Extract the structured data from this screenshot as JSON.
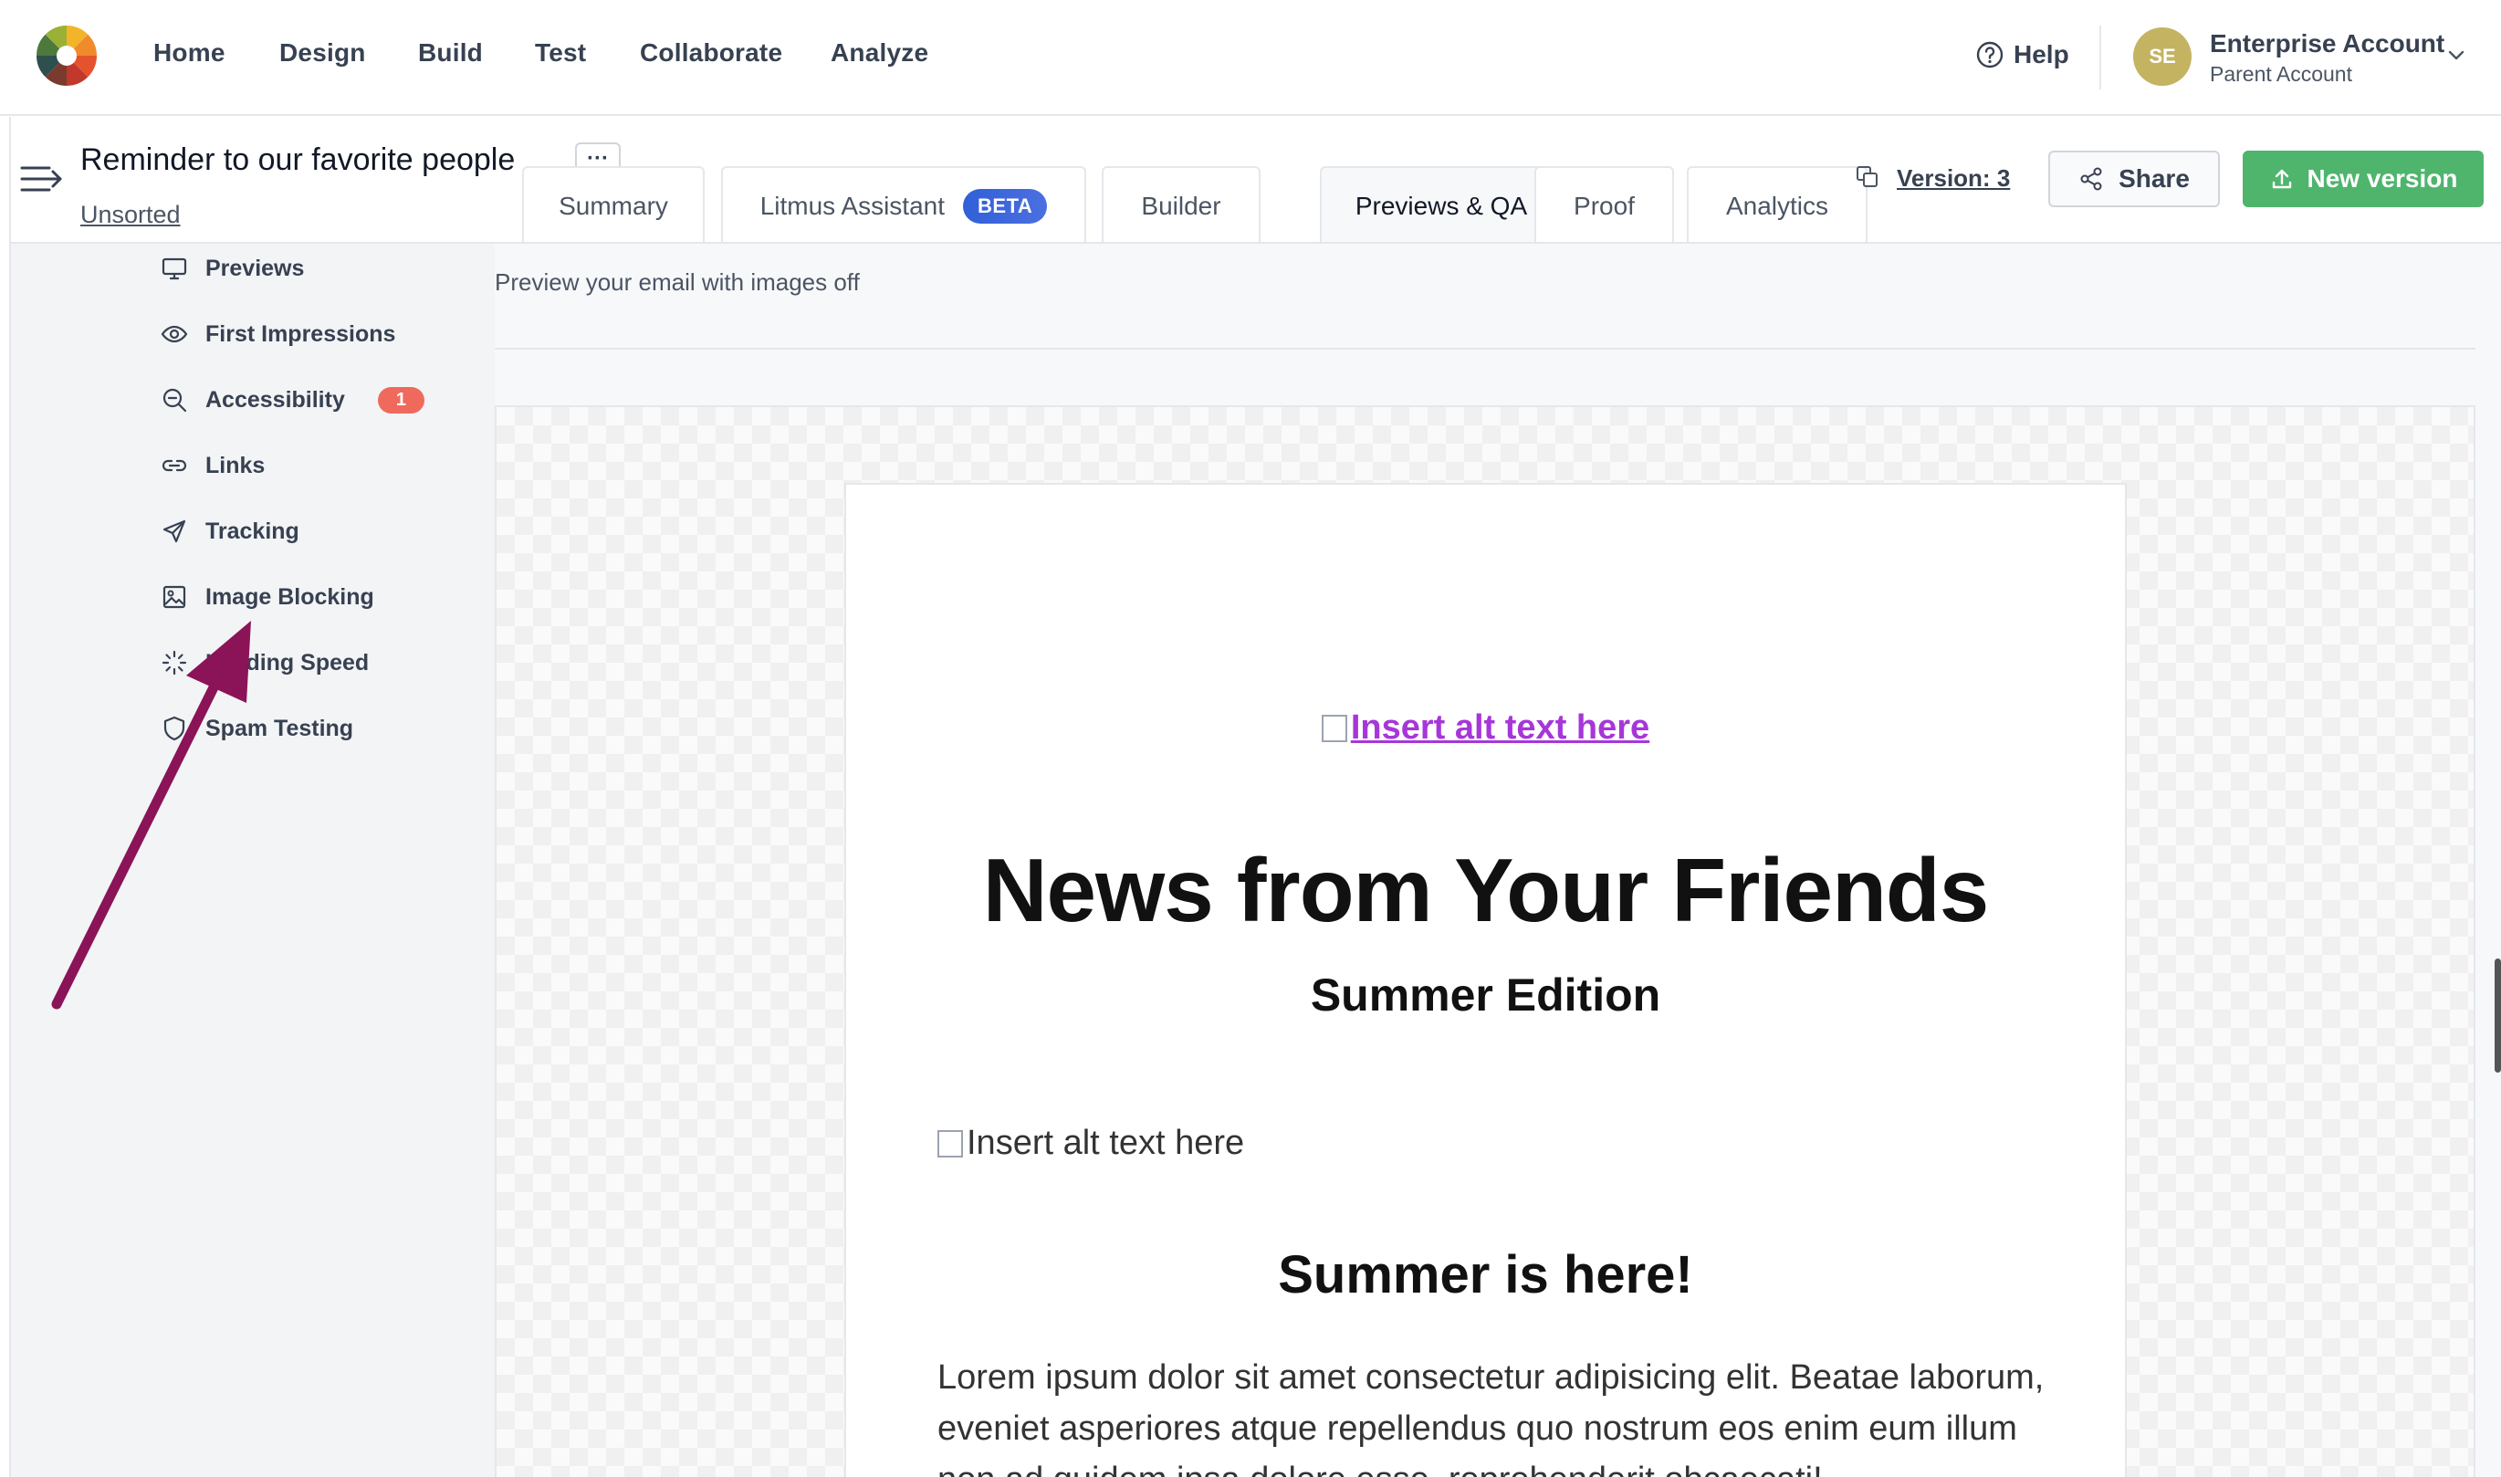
{
  "nav": {
    "items": [
      "Home",
      "Design",
      "Build",
      "Test",
      "Collaborate",
      "Analyze"
    ],
    "help": "Help",
    "account": {
      "initials": "SE",
      "name": "Enterprise Account",
      "sub": "Parent Account"
    }
  },
  "project": {
    "title": "Reminder to our favorite people",
    "more": "···",
    "folder": "Unsorted"
  },
  "tabs": [
    {
      "label": "Summary"
    },
    {
      "label": "Litmus Assistant",
      "badge": "BETA"
    },
    {
      "label": "Builder"
    },
    {
      "label": "Previews & QA"
    },
    {
      "label": "Proof"
    },
    {
      "label": "Analytics"
    }
  ],
  "actions": {
    "version": "Version: 3",
    "share": "Share",
    "new_version": "New version"
  },
  "sidebar": {
    "items": [
      {
        "label": "Previews",
        "icon": "monitor-icon"
      },
      {
        "label": "First Impressions",
        "icon": "eye-icon"
      },
      {
        "label": "Accessibility",
        "icon": "magnifier-icon",
        "badge": "1"
      },
      {
        "label": "Links",
        "icon": "link-icon"
      },
      {
        "label": "Tracking",
        "icon": "send-icon"
      },
      {
        "label": "Image Blocking",
        "icon": "image-icon"
      },
      {
        "label": "Loading Speed",
        "icon": "spinner-icon"
      },
      {
        "label": "Spam Testing",
        "icon": "shield-icon"
      }
    ]
  },
  "main": {
    "caption": "Preview your email with images off",
    "email": {
      "alt_link": "Insert alt text here",
      "heading": "News from Your Friends",
      "subheading": "Summer Edition",
      "alt_plain": "Insert alt text here",
      "section_heading": "Summer is here!",
      "body": "Lorem ipsum dolor sit amet consectetur adipisicing elit. Beatae laborum, eveniet asperiores atque repellendus quo nostrum eos enim eum illum non ad quidem ipsa dolore esse, reprehenderit obcaecati!"
    }
  },
  "colors": {
    "accent_green": "#4fb56d",
    "badge_red": "#ef6a5c",
    "beta_blue": "#3b5bdb",
    "link_purple": "#a736d9",
    "arrow": "#8a1457"
  }
}
